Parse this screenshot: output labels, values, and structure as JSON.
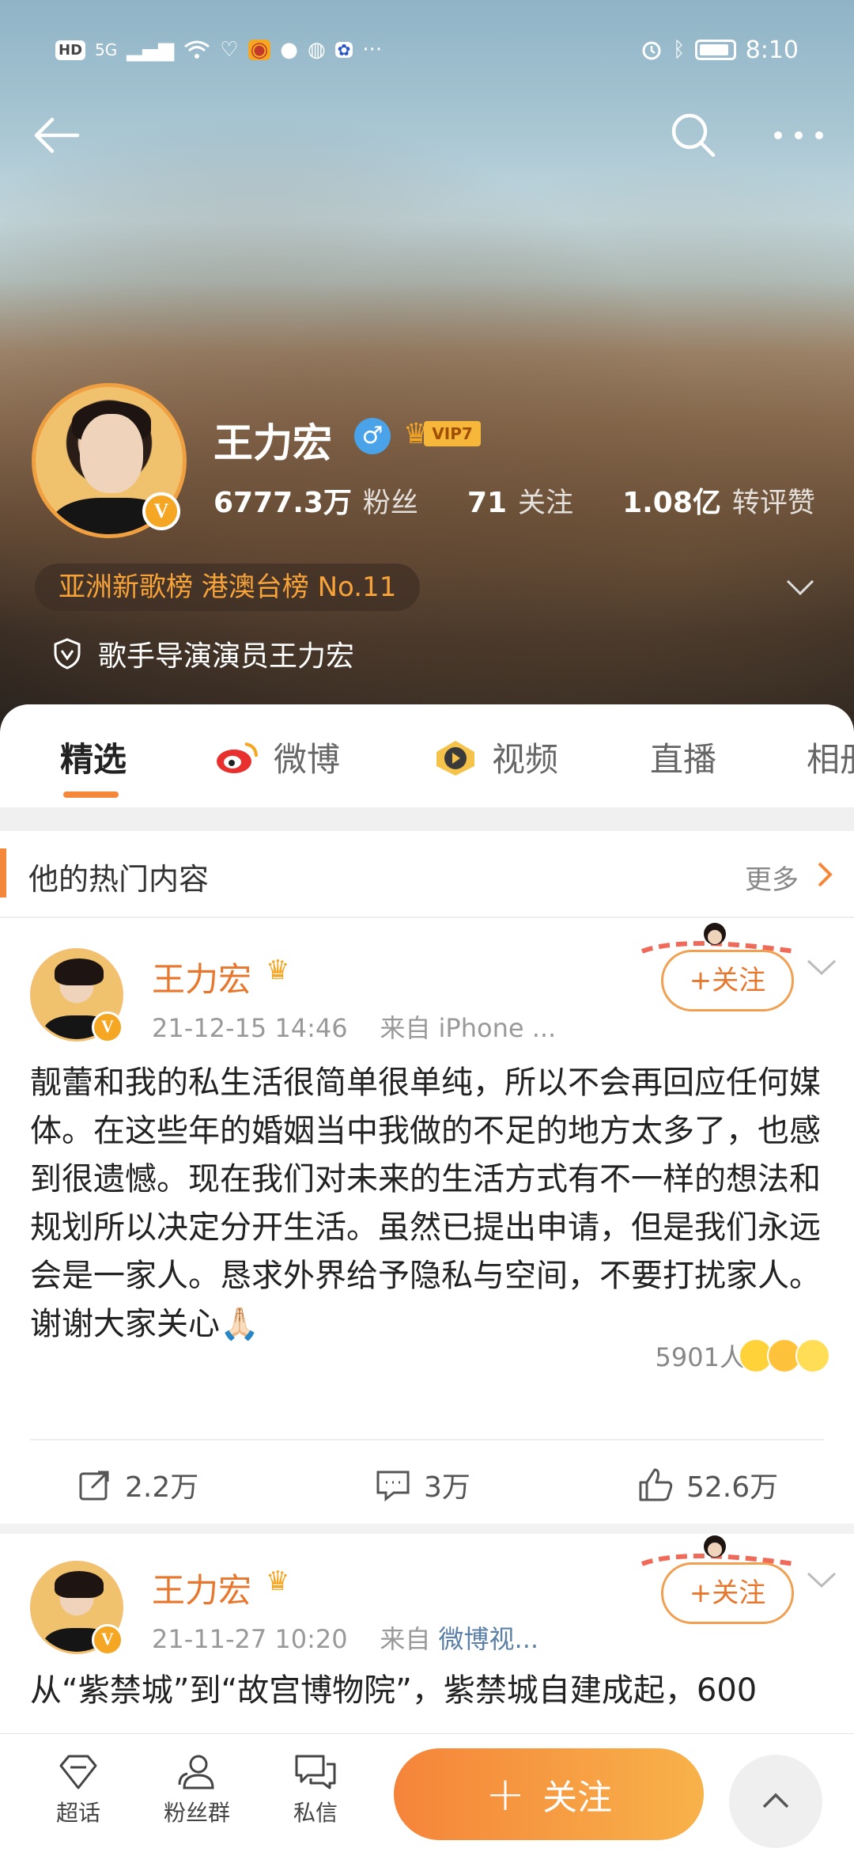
{
  "status_bar": {
    "left_badges": [
      "HD",
      "5G"
    ],
    "time": "8:10"
  },
  "profile": {
    "name": "王力宏",
    "gender_symbol": "♂",
    "vip_label": "VIP7",
    "stats": [
      {
        "value": "6777.3万",
        "label": "粉丝"
      },
      {
        "value": "71",
        "label": "关注"
      },
      {
        "value": "1.08亿",
        "label": "转评赞"
      }
    ],
    "rank_text": "亚洲新歌榜 港澳台榜 No.11",
    "certification": "歌手导演演员王力宏",
    "verified_letter": "V"
  },
  "tabs": [
    {
      "label": "精选"
    },
    {
      "label": "微博"
    },
    {
      "label": "视频"
    },
    {
      "label": "直播"
    },
    {
      "label": "相册"
    }
  ],
  "hot_section": {
    "title": "他的热门内容",
    "more_label": "更多"
  },
  "posts": [
    {
      "author": "王力宏",
      "date": "21-12-15 14:46",
      "source_prefix": "来自",
      "source": "iPhone ...",
      "follow_label": "+关注",
      "text": "靓蕾和我的私生活很简单很单纯，所以不会再回应任何媒体。在这些年的婚姻当中我做的不足的地方太多了，也感到很遗憾。现在我们对未来的生活方式有不一样的想法和规划所以决定分开生活。虽然已提出申请，但是我们永远会是一家人。恳求外界给予隐私与空间，不要打扰家人。谢谢大家关心🙏🏻",
      "reaction_count": "5901人",
      "reposts": "2.2万",
      "comments": "3万",
      "likes": "52.6万"
    },
    {
      "author": "王力宏",
      "date": "21-11-27 10:20",
      "source_prefix": "来自",
      "source": "微博视...",
      "follow_label": "+关注",
      "text": "从“紫禁城”到“故宫博物院”，紫禁城自建成起，600"
    }
  ],
  "bottom_bar": {
    "items": [
      {
        "label": "超话"
      },
      {
        "label": "粉丝群"
      },
      {
        "label": "私信"
      }
    ],
    "follow_label": "关注",
    "follow_plus": "+"
  },
  "colors": {
    "accent": "#f5873a",
    "name_orange": "#e8772e",
    "link_blue": "#5b7fa6"
  }
}
